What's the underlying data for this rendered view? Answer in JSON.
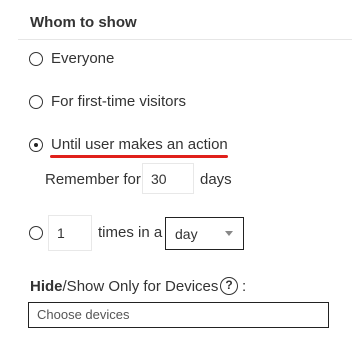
{
  "section_title": "Whom to show",
  "options": [
    {
      "label": "Everyone",
      "checked": false
    },
    {
      "label": "For first-time visitors",
      "checked": false
    },
    {
      "label": "Until user makes an action",
      "checked": true
    }
  ],
  "remember": {
    "prefix": "Remember for",
    "value": "30",
    "suffix": "days"
  },
  "times": {
    "value": "1",
    "label": "times in a",
    "period": "day"
  },
  "devices": {
    "title_bold": "Hide",
    "title_rest": "/Show Only for Devices",
    "help_symbol": "?",
    "colon": ":",
    "placeholder": "Choose devices"
  },
  "accent_color": "#e0201b"
}
